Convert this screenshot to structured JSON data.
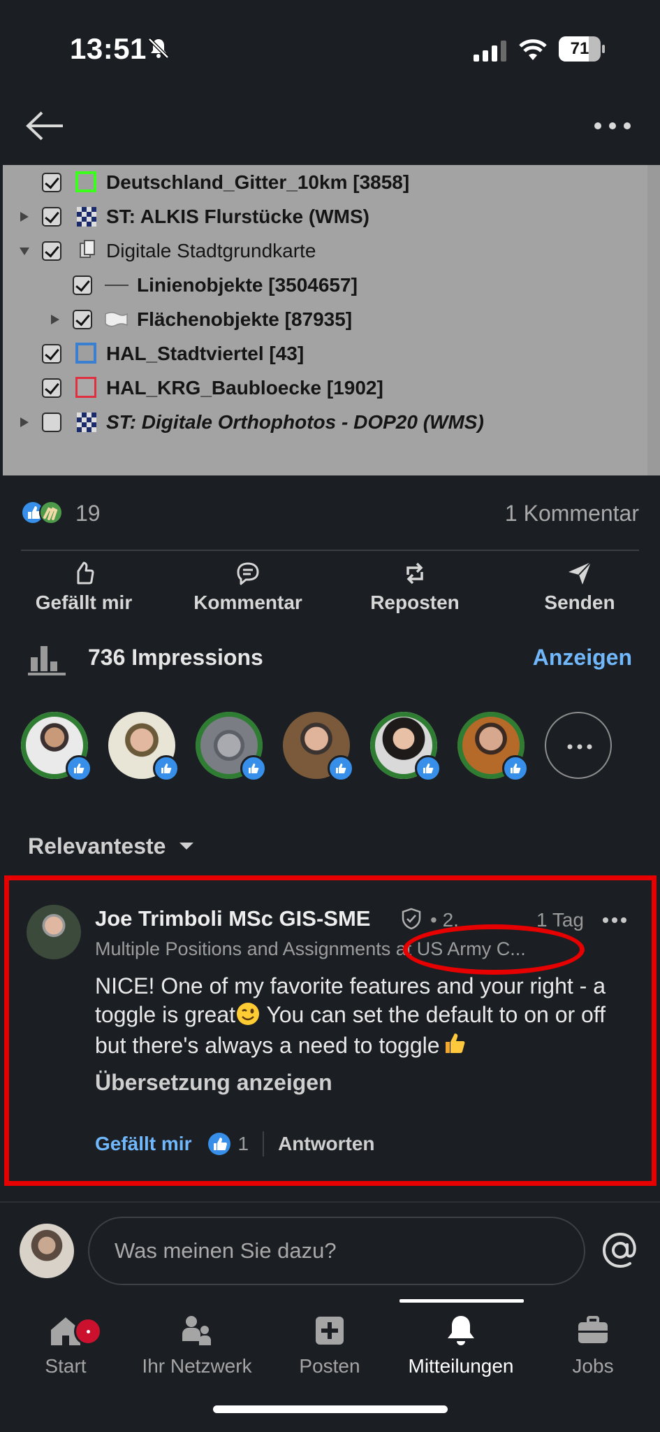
{
  "status_bar": {
    "time": "13:51",
    "battery_level": "71",
    "battery_fraction": 0.71
  },
  "post_image": {
    "layers": [
      {
        "label": "Deutschland_Gitter_10km [3858]",
        "checked": true,
        "expand_arrow": false,
        "style": "bold",
        "symbol": "green-square-icon"
      },
      {
        "label": "ST: ALKIS Flurstücke (WMS)",
        "checked": true,
        "expand_arrow": true,
        "style": "bold",
        "symbol": "wms-checker-icon"
      },
      {
        "label": "Digitale Stadtgrundkarte",
        "checked": true,
        "expand_arrow": true,
        "expanded": true,
        "style": "normal",
        "symbol": "group-icon"
      },
      {
        "label": "Linienobjekte [3504657]",
        "checked": true,
        "expand_arrow": false,
        "style": "bold",
        "symbol": "line-icon"
      },
      {
        "label": "Flächenobjekte [87935]",
        "checked": true,
        "expand_arrow": true,
        "style": "bold",
        "symbol": "polygon-icon"
      },
      {
        "label": "HAL_Stadtviertel [43]",
        "checked": true,
        "expand_arrow": false,
        "style": "bold",
        "symbol": "blue-square-icon"
      },
      {
        "label": "HAL_KRG_Baubloecke [1902]",
        "checked": true,
        "expand_arrow": false,
        "style": "bold",
        "symbol": "red-square-icon"
      },
      {
        "label": "ST: Digitale Orthophotos - DOP20 (WMS)",
        "checked": false,
        "expand_arrow": true,
        "style": "bold-italic",
        "symbol": "wms-checker-icon"
      }
    ]
  },
  "social": {
    "reaction_count": "19",
    "comment_count": "1 Kommentar"
  },
  "actions": {
    "like": "Gefällt mir",
    "comment": "Kommentar",
    "repost": "Reposten",
    "send": "Senden"
  },
  "impressions": {
    "label": "736 Impressions",
    "link": "Anzeigen"
  },
  "sort": {
    "label": "Relevanteste"
  },
  "comment": {
    "author": "Joe Trimboli MSc GIS-SME",
    "degree": "• 2.",
    "time": "1 Tag",
    "headline": "Multiple Positions and Assignments at US Army C...",
    "text": "NICE! One of my favorite features and your right - a toggle is great",
    "text_2": " You can set the default to on or off but there's always a need to toggle",
    "translate": "Übersetzung anzeigen",
    "like_label": "Gefällt mir",
    "like_count": "1",
    "reply_label": "Antworten"
  },
  "composer": {
    "placeholder": "Was meinen Sie dazu?"
  },
  "tabbar": {
    "tabs": [
      {
        "label": "Start",
        "icon": "home-icon",
        "active": false,
        "badge": true
      },
      {
        "label": "Ihr Netzwerk",
        "icon": "people-icon",
        "active": false
      },
      {
        "label": "Posten",
        "icon": "plus-square-icon",
        "active": false
      },
      {
        "label": "Mitteilungen",
        "icon": "bell-icon",
        "active": true
      },
      {
        "label": "Jobs",
        "icon": "briefcase-icon",
        "active": false
      }
    ]
  },
  "colors": {
    "background": "#1b1f23",
    "link_blue": "#71b7fb",
    "annotation_red": "#e60000",
    "notification_red": "#cb112d"
  }
}
